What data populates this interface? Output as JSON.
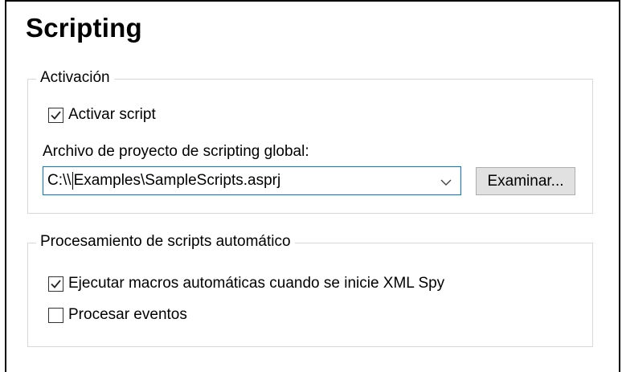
{
  "page": {
    "title": "Scripting"
  },
  "activation": {
    "legend": "Activación",
    "enable_scripting": {
      "label": "Activar script",
      "checked": true
    },
    "project_file": {
      "label": "Archivo de proyecto de scripting global:",
      "value_before_caret": "C:\\\\",
      "value_after_caret": "Examples\\SampleScripts.asprj",
      "dropdown_icon": "chevron-down-icon"
    },
    "browse_label": "Examinar..."
  },
  "auto_processing": {
    "legend": "Procesamiento de scripts automático",
    "run_macros": {
      "label": "Ejecutar macros automáticas cuando se inicie XML Spy",
      "checked": true
    },
    "process_events": {
      "label": "Procesar eventos",
      "checked": false
    }
  },
  "colors": {
    "focus_border": "#0078d7",
    "button_bg": "#e1e1e1",
    "group_border": "#d8d8d8"
  }
}
